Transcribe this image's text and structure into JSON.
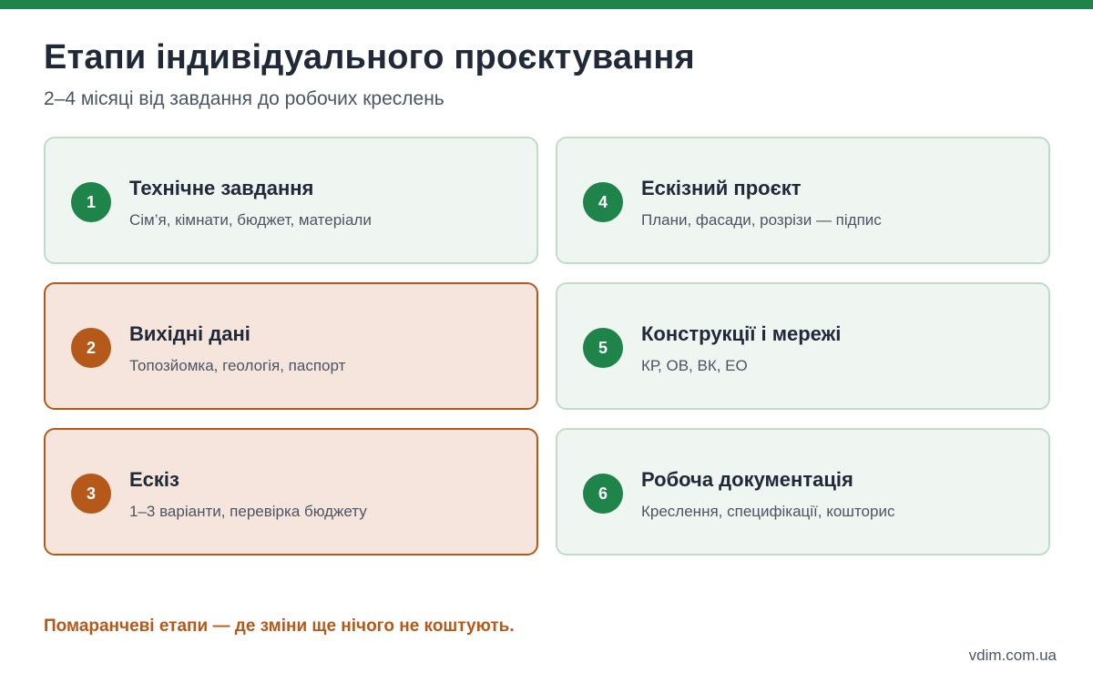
{
  "header": {
    "title": "Етапи індивідуального проєктування",
    "subtitle": "2–4 місяці від завдання до робочих креслень"
  },
  "colors": {
    "brand_green": "#1e8449",
    "accent_orange": "#b5591a",
    "card_green_bg": "#eff6f1",
    "card_orange_bg": "#f6e5dd"
  },
  "stages": [
    {
      "number": "1",
      "title": "Технічне завдання",
      "description": "Сім’я, кімнати, бюджет, матеріали",
      "accent": false
    },
    {
      "number": "2",
      "title": "Вихідні дані",
      "description": "Топозйомка, геологія, паспорт",
      "accent": true
    },
    {
      "number": "3",
      "title": "Ескіз",
      "description": "1–3 варіанти, перевірка бюджету",
      "accent": true
    },
    {
      "number": "4",
      "title": "Ескізний проєкт",
      "description": "Плани, фасади, розрізи — підпис",
      "accent": false
    },
    {
      "number": "5",
      "title": "Конструкції і мережі",
      "description": "КР, ОВ, ВК, ЕО",
      "accent": false
    },
    {
      "number": "6",
      "title": "Робоча документація",
      "description": "Креслення, специфікації, кошторис",
      "accent": false
    }
  ],
  "footer": {
    "note": "Помаранчеві етапи — де зміни ще нічого не коштують.",
    "site": "vdim.com.ua"
  }
}
